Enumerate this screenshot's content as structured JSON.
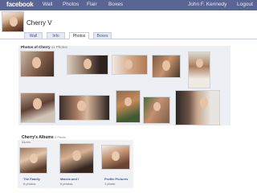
{
  "topbar": {
    "logo": "facebook",
    "nav": [
      "Wall",
      "Photos",
      "Flair",
      "Boxes"
    ],
    "user": "John F. Kennedy",
    "logout": "Logout"
  },
  "profile": {
    "name": "Cherry V"
  },
  "tabs": [
    "Wall",
    "Info",
    "Photos",
    "Boxes"
  ],
  "photos_section": {
    "title": "Photos of Cherry",
    "sub": "11 Photos"
  },
  "albums_section": {
    "title": "Cherry's Albums",
    "count": "3 Photo",
    "sub": "Alums",
    "albums": [
      {
        "name": "The Family",
        "count": "6 photos"
      },
      {
        "name": "Marcia and I",
        "count": "6 photos"
      },
      {
        "name": "Profile Pictures",
        "count": "1 photo"
      }
    ]
  }
}
